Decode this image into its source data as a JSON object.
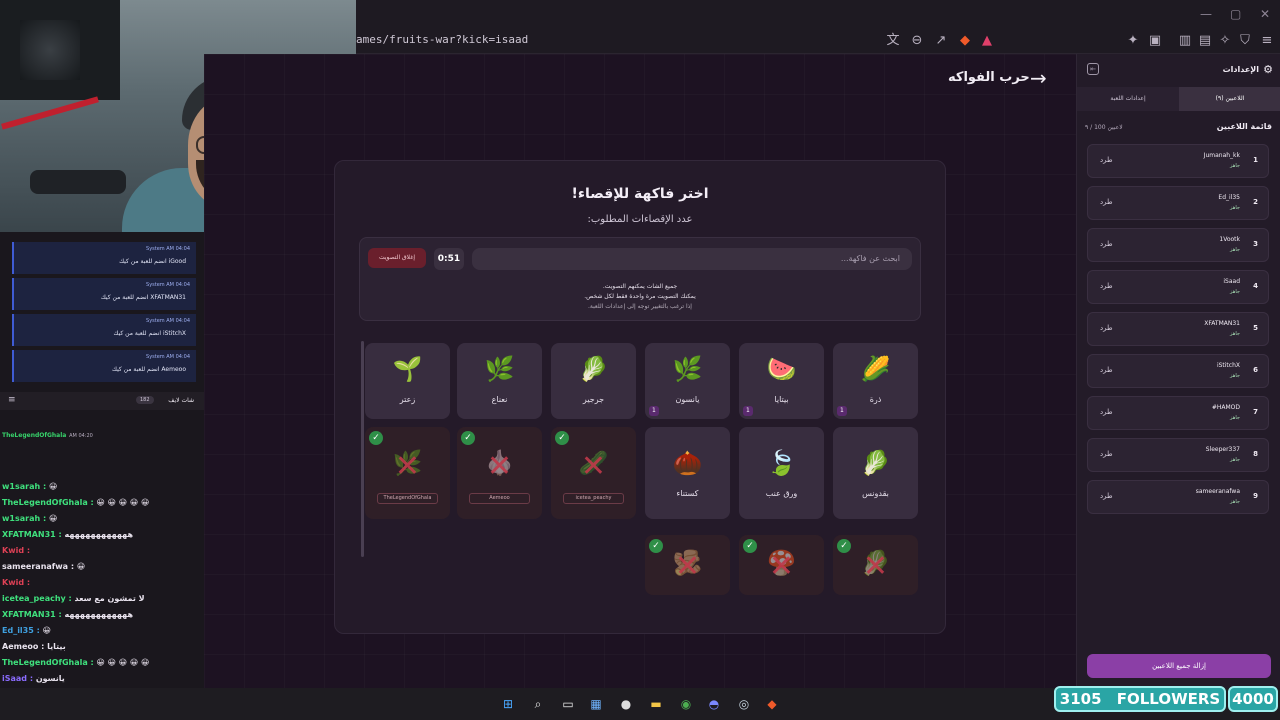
{
  "browser": {
    "url": "ames/fruits-war?kick=isaad"
  },
  "page": {
    "title": "حرب الفواكه",
    "heading": "اختر فاكهة للإقصاء!",
    "required_label": "عدد الإقصاءات المطلوب:",
    "search_placeholder": "ابحث عن فاكهة...",
    "timer": "0:51",
    "close_vote_label": "إغلاق التصويت",
    "notes": [
      "جميع الشات يمكنهم التصويت.",
      "يمكنك التصويت مرة واحدة فقط لكل شخص.",
      "إذا ترغب بالتغيير توجه إلى إعدادات اللعبة."
    ],
    "fruits": [
      {
        "label": "ذرة",
        "emoji": "🌽",
        "votes": "1"
      },
      {
        "label": "بيتايا",
        "emoji": "🍉",
        "votes": "1"
      },
      {
        "label": "يانسون",
        "emoji": "🌿",
        "votes": "1"
      },
      {
        "label": "جرجير",
        "emoji": "🥬",
        "votes": ""
      },
      {
        "label": "نعناع",
        "emoji": "🌿",
        "votes": ""
      },
      {
        "label": "زعتر",
        "emoji": "🌱",
        "votes": ""
      },
      {
        "label": "بقدونس",
        "emoji": "🥬",
        "votes": ""
      },
      {
        "label": "ورق عنب",
        "emoji": "🍃",
        "votes": ""
      },
      {
        "label": "كستناء",
        "emoji": "🌰",
        "votes": ""
      }
    ],
    "eliminated": [
      {
        "emoji": "🥒",
        "who": "icetea_peachy"
      },
      {
        "emoji": "🧄",
        "who": "Aemeoo"
      },
      {
        "emoji": "🌿",
        "who": "TheLegendOfGhala"
      },
      {
        "emoji": "🥬",
        "who": ""
      },
      {
        "emoji": "🍄",
        "who": ""
      },
      {
        "emoji": "🫚",
        "who": ""
      }
    ]
  },
  "sidebar": {
    "title": "الإعدادات",
    "tabs": [
      "اللاعبين (٩)",
      "إعدادات اللعبة"
    ],
    "players_title": "قائمة اللاعبين",
    "players_count": "٩ / 100 لاعبين",
    "kick_label": "طرد",
    "status_label": "جاهز",
    "players": [
      {
        "num": "1",
        "name": "Jumanah_kk"
      },
      {
        "num": "2",
        "name": "Ed_il35"
      },
      {
        "num": "3",
        "name": "1Vootk"
      },
      {
        "num": "4",
        "name": "iSaad"
      },
      {
        "num": "5",
        "name": "XFATMAN31"
      },
      {
        "num": "6",
        "name": "iStitchX"
      },
      {
        "num": "7",
        "name": "#HAMOD"
      },
      {
        "num": "8",
        "name": "Sleeper337"
      },
      {
        "num": "9",
        "name": "sameeranafwa"
      }
    ],
    "remove_all_label": "إزالة جميع اللاعبين"
  },
  "chat": {
    "system_messages": [
      {
        "meta": "System AM 04:04",
        "body": "iGood انضم للعبة من كيك"
      },
      {
        "meta": "System AM 04:04",
        "body": "XFATMAN31 انضم للعبة من كيك"
      },
      {
        "meta": "System AM 04:04",
        "body": "iStitchX انضم للعبة من كيك"
      },
      {
        "meta": "System AM 04:04",
        "body": "Aemeoo انضم للعبة من كيك"
      }
    ],
    "header_title": "شات لايف",
    "header_count": "182",
    "lines": [
      {
        "user": "TheLegendOfGhala",
        "text": "AM 04:20",
        "color": "#37d36b"
      },
      {
        "user": "w1sarah :",
        "text": "😀",
        "color": "#3fe07d"
      },
      {
        "user": "TheLegendOfGhala :",
        "text": "😀 😀 😀 😀 😀",
        "color": "#3fe07d"
      },
      {
        "user": "w1sarah :",
        "text": "😀",
        "color": "#3fe07d"
      },
      {
        "user": "XFATMAN31 :",
        "text": "ههههههههههههه",
        "color": "#3fe07d"
      },
      {
        "user": "Kwid :",
        "text": "",
        "color": "#e04156"
      },
      {
        "user": "sameeranafwa :",
        "text": "😀",
        "color": "#e9e3ee"
      },
      {
        "user": "Kwid :",
        "text": "",
        "color": "#e04156"
      },
      {
        "user": "icetea_peachy :",
        "text": "لا تمشون مع سعد",
        "color": "#3fe07d"
      },
      {
        "user": "XFATMAN31 :",
        "text": "ههههههههههههه",
        "color": "#3fe07d"
      },
      {
        "user": "Ed_il35 :",
        "text": "😀",
        "color": "#3fa0e0"
      },
      {
        "user": "Aemeoo :",
        "text": "بيتايا",
        "color": "#e9e3ee"
      },
      {
        "user": "TheLegendOfGhala :",
        "text": "😀 😀 😀 😀 😀",
        "color": "#3fe07d"
      },
      {
        "user": "iSaad :",
        "text": "يانسون",
        "color": "#8b6cff"
      }
    ]
  },
  "overlay": {
    "followers_count": "3105",
    "followers_label": "FOLLOWERS",
    "goal": "4000"
  }
}
